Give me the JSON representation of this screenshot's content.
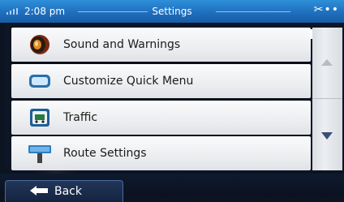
{
  "status": {
    "time": "2:08 pm",
    "title": "Settings",
    "gps_icon": "gps-satellite-icon",
    "signal_icon": "signal-bars-icon"
  },
  "menu": {
    "items": [
      {
        "label": "Sound and Warnings",
        "icon": "speaker-icon"
      },
      {
        "label": "Customize Quick Menu",
        "icon": "quick-menu-icon"
      },
      {
        "label": "Traffic",
        "icon": "traffic-icon"
      },
      {
        "label": "Route Settings",
        "icon": "route-settings-icon"
      }
    ]
  },
  "scroll": {
    "up_icon": "scroll-up-icon",
    "down_icon": "scroll-down-icon"
  },
  "footer": {
    "back_label": "Back",
    "back_icon": "back-arrow-icon"
  },
  "colors": {
    "status_blue": "#1f6fbf",
    "list_bg": "#eceef1",
    "back_btn": "#142440"
  }
}
